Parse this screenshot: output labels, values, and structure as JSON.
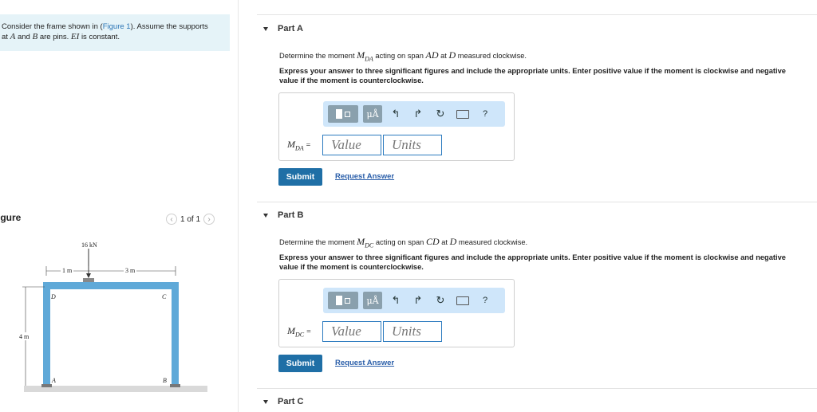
{
  "intro": {
    "text_before_link": "Consider the frame shown in (",
    "figure_link": "Figure 1",
    "text_after_link": "). Assume the supports",
    "line2_at": "at",
    "var_a": "A",
    "line2_and": "and",
    "var_b": "B",
    "line2_pins": "are pins.",
    "var_ei": "EI",
    "line2_end": "is constant."
  },
  "figure": {
    "label": "igure",
    "pager": "1 of 1",
    "prev_icon": "chevron-left",
    "next_icon": "chevron-right",
    "load": "16 kN",
    "dim_left": "1 m",
    "dim_right": "3 m",
    "dim_height": "4 m",
    "node_d": "D",
    "node_c": "C",
    "node_a": "A",
    "node_b": "B"
  },
  "parts": [
    {
      "title": "Part A",
      "q_prefix": "Determine the moment",
      "q_var": "M",
      "q_sub": "DA",
      "q_mid": "acting on span",
      "q_span": "AD",
      "q_at": "at",
      "q_node": "D",
      "q_suffix": "measured clockwise.",
      "instructions": "Express your answer to three significant figures and include the appropriate units. Enter positive value if the moment is clockwise and negative value if the moment is counterclockwise.",
      "label_var": "M",
      "label_sub": "DA",
      "label_eq": "=",
      "value_placeholder": "Value",
      "units_placeholder": "Units",
      "submit": "Submit",
      "request": "Request Answer"
    },
    {
      "title": "Part B",
      "q_prefix": "Determine the moment",
      "q_var": "M",
      "q_sub": "DC",
      "q_mid": "acting on span",
      "q_span": "CD",
      "q_at": "at",
      "q_node": "D",
      "q_suffix": "measured clockwise.",
      "instructions": "Express your answer to three significant figures and include the appropriate units. Enter positive value if the moment is clockwise and negative value if the moment is counterclockwise.",
      "label_var": "M",
      "label_sub": "DC",
      "label_eq": "=",
      "value_placeholder": "Value",
      "units_placeholder": "Units",
      "submit": "Submit",
      "request": "Request Answer"
    },
    {
      "title": "Part C"
    }
  ],
  "toolbar": {
    "mu_label": "μÅ",
    "undo_icon": "↰",
    "redo_icon": "↱",
    "reset_icon": "↻",
    "help_label": "?"
  }
}
